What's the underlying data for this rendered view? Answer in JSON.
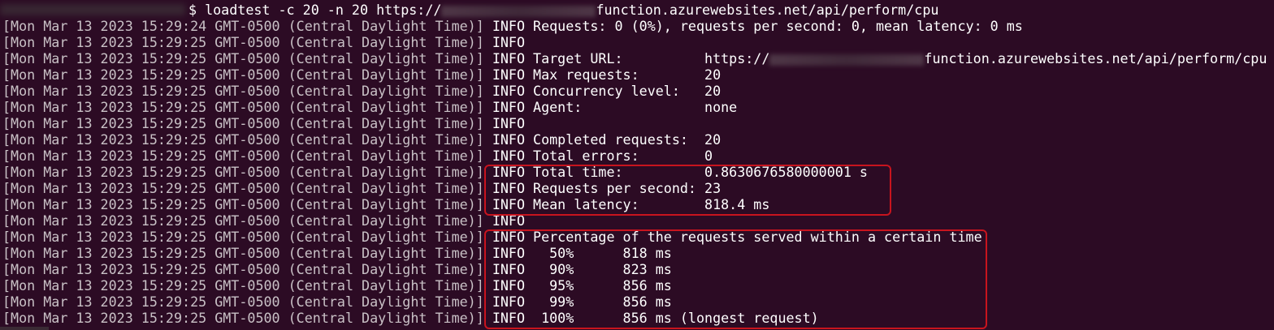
{
  "command": {
    "prompt": "$",
    "text_before": "loadtest -c 20 -n 20 https://",
    "text_after": "function.azurewebsites.net/api/perform/cpu"
  },
  "log": [
    {
      "ts": "[Mon Mar 13 2023 15:29:24 GMT-0500 (Central Daylight Time)]",
      "level": "INFO",
      "msg": "Requests: 0 (0%), requests per second: 0, mean latency: 0 ms"
    },
    {
      "ts": "[Mon Mar 13 2023 15:29:25 GMT-0500 (Central Daylight Time)]",
      "level": "INFO",
      "msg": ""
    },
    {
      "ts": "[Mon Mar 13 2023 15:29:25 GMT-0500 (Central Daylight Time)]",
      "level": "INFO",
      "msg": "Target URL:          https://",
      "msg_after": "function.azurewebsites.net/api/perform/cpu",
      "blurred": true
    },
    {
      "ts": "[Mon Mar 13 2023 15:29:25 GMT-0500 (Central Daylight Time)]",
      "level": "INFO",
      "msg": "Max requests:        20"
    },
    {
      "ts": "[Mon Mar 13 2023 15:29:25 GMT-0500 (Central Daylight Time)]",
      "level": "INFO",
      "msg": "Concurrency level:   20"
    },
    {
      "ts": "[Mon Mar 13 2023 15:29:25 GMT-0500 (Central Daylight Time)]",
      "level": "INFO",
      "msg": "Agent:               none"
    },
    {
      "ts": "[Mon Mar 13 2023 15:29:25 GMT-0500 (Central Daylight Time)]",
      "level": "INFO",
      "msg": ""
    },
    {
      "ts": "[Mon Mar 13 2023 15:29:25 GMT-0500 (Central Daylight Time)]",
      "level": "INFO",
      "msg": "Completed requests:  20"
    },
    {
      "ts": "[Mon Mar 13 2023 15:29:25 GMT-0500 (Central Daylight Time)]",
      "level": "INFO",
      "msg": "Total errors:        0"
    },
    {
      "ts": "[Mon Mar 13 2023 15:29:25 GMT-0500 (Central Daylight Time)]",
      "level": "INFO",
      "msg": "Total time:          0.8630676580000001 s"
    },
    {
      "ts": "[Mon Mar 13 2023 15:29:25 GMT-0500 (Central Daylight Time)]",
      "level": "INFO",
      "msg": "Requests per second: 23"
    },
    {
      "ts": "[Mon Mar 13 2023 15:29:25 GMT-0500 (Central Daylight Time)]",
      "level": "INFO",
      "msg": "Mean latency:        818.4 ms"
    },
    {
      "ts": "[Mon Mar 13 2023 15:29:25 GMT-0500 (Central Daylight Time)]",
      "level": "INFO",
      "msg": ""
    },
    {
      "ts": "[Mon Mar 13 2023 15:29:25 GMT-0500 (Central Daylight Time)]",
      "level": "INFO",
      "msg": "Percentage of the requests served within a certain time"
    },
    {
      "ts": "[Mon Mar 13 2023 15:29:25 GMT-0500 (Central Daylight Time)]",
      "level": "INFO",
      "msg": "  50%      818 ms"
    },
    {
      "ts": "[Mon Mar 13 2023 15:29:25 GMT-0500 (Central Daylight Time)]",
      "level": "INFO",
      "msg": "  90%      823 ms"
    },
    {
      "ts": "[Mon Mar 13 2023 15:29:25 GMT-0500 (Central Daylight Time)]",
      "level": "INFO",
      "msg": "  95%      856 ms"
    },
    {
      "ts": "[Mon Mar 13 2023 15:29:25 GMT-0500 (Central Daylight Time)]",
      "level": "INFO",
      "msg": "  99%      856 ms"
    },
    {
      "ts": "[Mon Mar 13 2023 15:29:25 GMT-0500 (Central Daylight Time)]",
      "level": "INFO",
      "msg": " 100%      856 ms (longest request)"
    }
  ],
  "colors": {
    "background": "#2c0b24",
    "highlight_border": "#c8141e",
    "text": "#ffffff"
  }
}
